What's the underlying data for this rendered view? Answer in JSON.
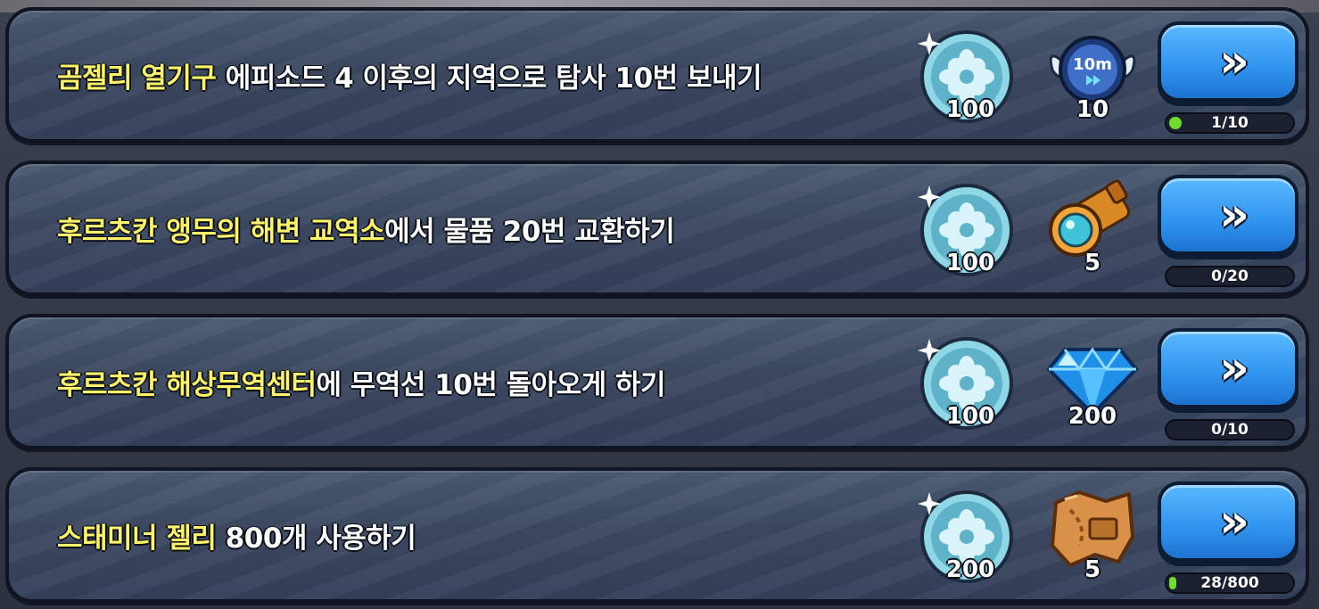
{
  "quests": [
    {
      "highlight": "곰젤리 열기구",
      "text": " 에피소드 4 이후의 지역으로 탐사 10번 보내기",
      "medal_amount": "100",
      "reward_icon": "time-skip-ticket-icon",
      "reward_icon_text": "10m",
      "reward_amount": "10",
      "progress_label": "1/10",
      "progress_fraction": 0.1
    },
    {
      "highlight": "후르츠칸 앵무의 해변 교역소",
      "text": "에서 물품 20번 교환하기",
      "medal_amount": "100",
      "reward_icon": "spyglass-icon",
      "reward_amount": "5",
      "progress_label": "0/20",
      "progress_fraction": 0
    },
    {
      "highlight": "후르츠칸 해상무역센터",
      "text": "에 무역선 10번 돌아오게 하기",
      "medal_amount": "100",
      "reward_icon": "crystal-gem-icon",
      "reward_amount": "200",
      "progress_label": "0/10",
      "progress_fraction": 0
    },
    {
      "highlight": "스태미너 젤리",
      "text": " 800개 사용하기",
      "medal_amount": "200",
      "reward_icon": "treasure-map-piece-icon",
      "reward_amount": "5",
      "progress_label": "28/800",
      "progress_fraction": 0.035
    }
  ],
  "go_button_symbol": "»",
  "colors": {
    "highlight": "#fff36a",
    "button": "#2f93ee",
    "progress": "#6fdc2e"
  }
}
